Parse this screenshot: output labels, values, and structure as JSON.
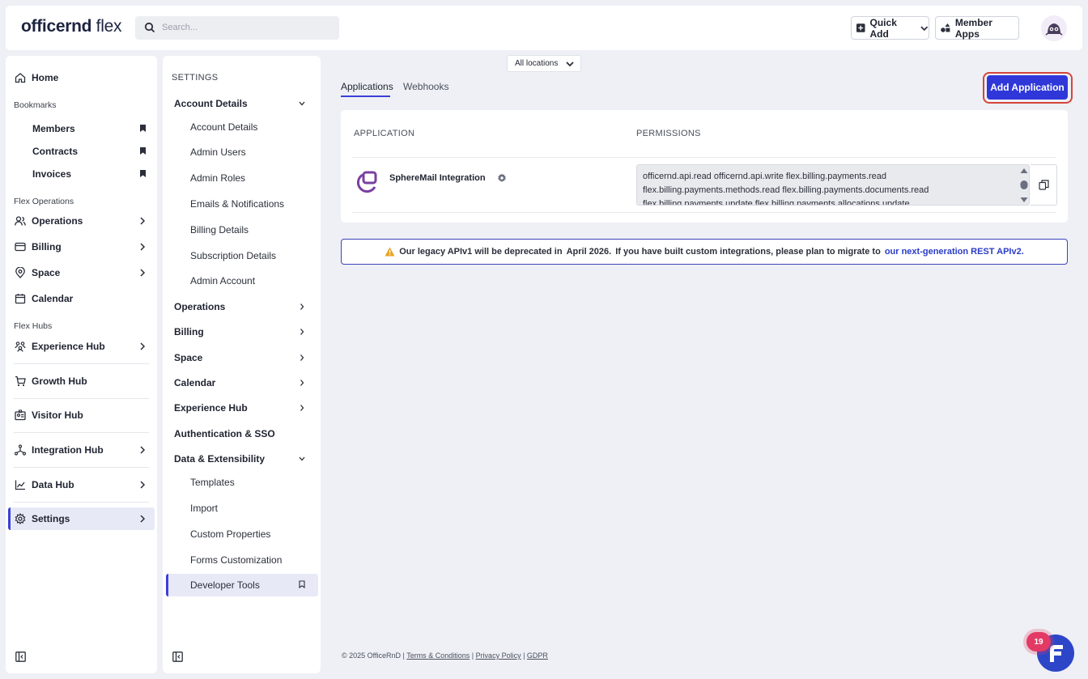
{
  "header": {
    "logo_text_bold": "officernd",
    "logo_text_light": " flex",
    "search_placeholder": "Search...",
    "quick_add_label": "Quick Add",
    "member_apps_label": "Member Apps"
  },
  "sidebar": {
    "home": "Home",
    "bookmarks_title": "Bookmarks",
    "bookmarks": [
      "Members",
      "Contracts",
      "Invoices"
    ],
    "flex_operations_title": "Flex Operations",
    "operations": "Operations",
    "billing": "Billing",
    "space": "Space",
    "calendar": "Calendar",
    "flex_hubs_title": "Flex Hubs",
    "experience_hub": "Experience Hub",
    "growth_hub": "Growth Hub",
    "visitor_hub": "Visitor Hub",
    "integration_hub": "Integration Hub",
    "data_hub": "Data Hub",
    "settings": "Settings"
  },
  "settings_panel": {
    "title": "SETTINGS",
    "account_details_group": "Account Details",
    "account_children": [
      "Account Details",
      "Admin Users",
      "Admin Roles",
      "Emails & Notifications",
      "Billing Details",
      "Subscription Details",
      "Admin Account"
    ],
    "operations": "Operations",
    "billing": "Billing",
    "space": "Space",
    "calendar": "Calendar",
    "experience_hub": "Experience Hub",
    "auth_sso": "Authentication & SSO",
    "data_ext_group": "Data & Extensibility",
    "data_children": [
      "Templates",
      "Import",
      "Custom Properties",
      "Forms Customization"
    ],
    "developer_tools": "Developer Tools"
  },
  "main": {
    "location_label": "All locations",
    "tabs": [
      "Applications",
      "Webhooks"
    ],
    "add_button": "Add Application",
    "table": {
      "col_application": "APPLICATION",
      "col_permissions": "PERMISSIONS",
      "rows": [
        {
          "name": "SphereMail Integration",
          "permissions_lines": [
            "officernd.api.read officernd.api.write flex.billing.payments.read",
            "flex.billing.payments.methods.read flex.billing.payments.documents.read",
            "flex.billing.payments.update flex.billing.payments.allocations.update"
          ]
        }
      ]
    },
    "notice": {
      "part1": "Our legacy APIv1 will be deprecated in",
      "date": "April 2026.",
      "part2": "If you have built custom integrations, please plan to migrate to",
      "link": "our next-generation REST APIv2."
    },
    "footer": {
      "copyright": "© 2025 OfficeRnD |",
      "terms": "Terms & Conditions",
      "privacy": "Privacy Policy",
      "gdpr": "GDPR"
    },
    "chat_badge_count": "19"
  },
  "colors": {
    "accent": "#2f37d9",
    "highlight_ring": "#d5453a",
    "badge": "#e23a64"
  }
}
